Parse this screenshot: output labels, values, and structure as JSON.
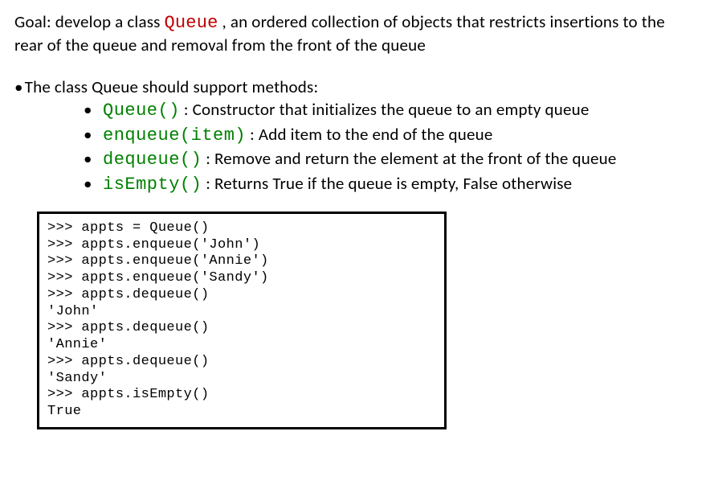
{
  "intro": {
    "prefix": "Goal: develop a class ",
    "class_name": "Queue",
    "suffix": " , an ordered collection of objects that restricts insertions to the rear of the queue and removal from the front of the queue"
  },
  "methods_intro": "The class Queue should support methods:",
  "methods": [
    {
      "sig": "Queue()",
      "sep": " :   ",
      "desc": "Constructor that initializes the queue to an empty queue"
    },
    {
      "sig": "enqueue(item)",
      "sep": " : ",
      "desc": "Add item to the end of the queue"
    },
    {
      "sig": "dequeue()",
      "sep": " : ",
      "desc": "Remove and return the element at the front of the queue"
    },
    {
      "sig": "isEmpty()",
      "sep": " : ",
      "desc": "Returns True if the queue is empty, False otherwise"
    }
  ],
  "code_example": ">>> appts = Queue()\n>>> appts.enqueue('John')\n>>> appts.enqueue('Annie')\n>>> appts.enqueue('Sandy')\n>>> appts.dequeue()\n'John'\n>>> appts.dequeue()\n'Annie'\n>>> appts.dequeue()\n'Sandy'\n>>> appts.isEmpty()\nTrue"
}
